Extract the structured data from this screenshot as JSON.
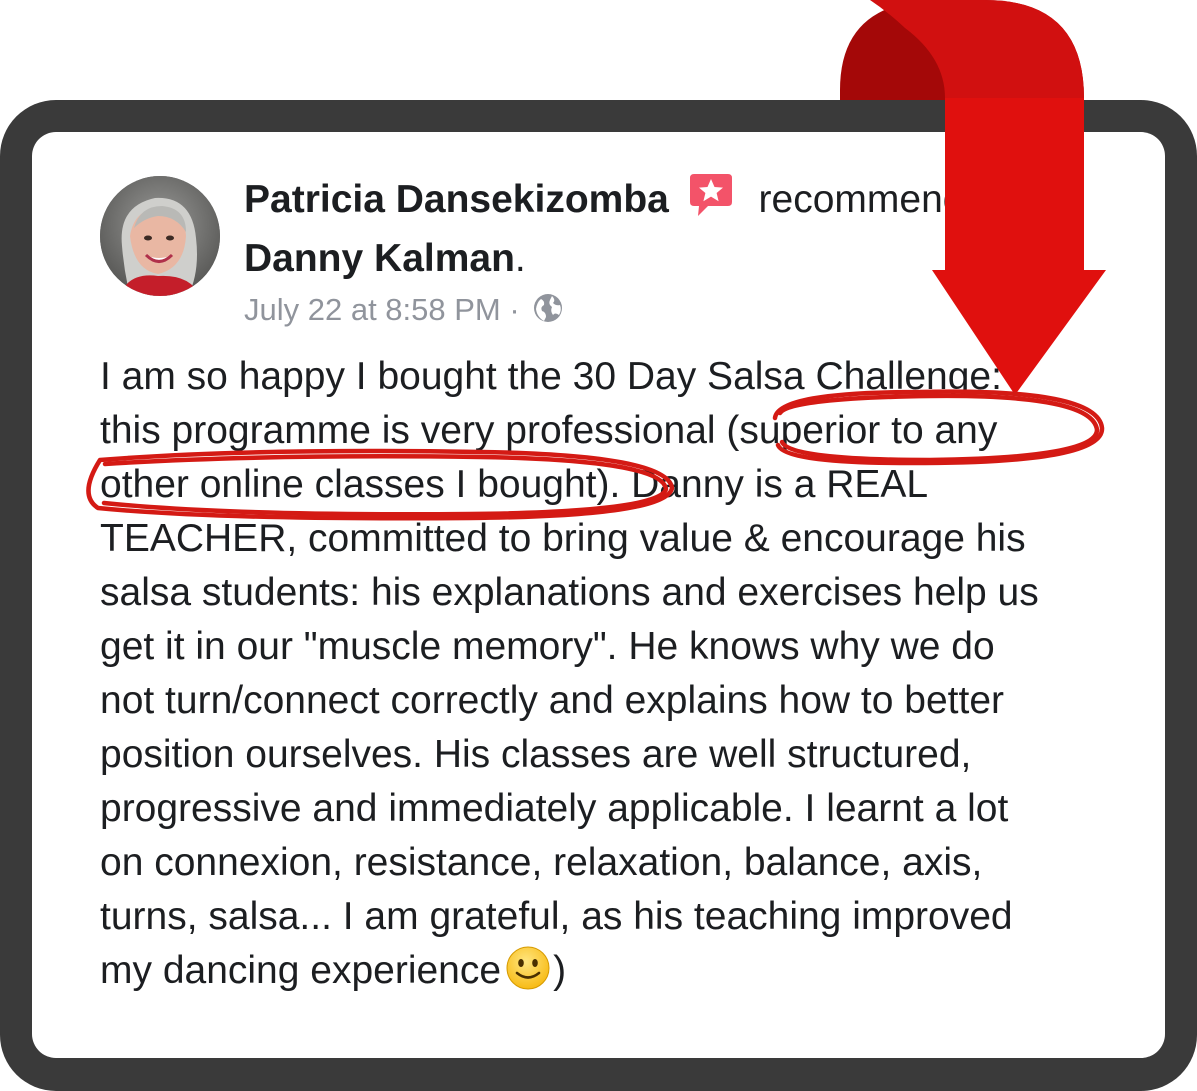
{
  "post": {
    "author": "Patricia Dansekizomba",
    "verb": "recommends",
    "page_name": "Danny Kalman",
    "page_suffix": ".",
    "timestamp": "July 22 at 8:58 PM",
    "separator": "·",
    "privacy_icon": "globe-icon",
    "recommend_icon": "recommendation-star-icon",
    "body_lines": [
      "I am so happy I bought the 30 Day Salsa Challenge:",
      "this programme is very professional (superior to any",
      "other online classes I bought). Danny is a REAL",
      "TEACHER, committed to bring value & encourage his",
      "salsa students: his explanations and exercises help us",
      "get it in our \"muscle memory\". He knows why we do",
      "not turn/connect correctly and explains how to better",
      "position ourselves. His classes are well structured,",
      "progressive and immediately applicable. I learnt a lot",
      "on connexion, resistance, relaxation, balance, axis,",
      "turns, salsa... I am grateful, as his teaching improved",
      "my dancing experience"
    ],
    "body_end": ")",
    "emoji": "slightly-smiling-face-icon"
  },
  "annotations": {
    "arrow_icon": "red-curved-arrow-icon",
    "highlight_icon": "red-circle-highlight-icon"
  },
  "colors": {
    "frame": "#3a3a3a",
    "card": "#ffffff",
    "text": "#1c1e21",
    "meta": "#90949c",
    "accent_red": "#e0281c",
    "recommend_pink": "#f35369"
  }
}
